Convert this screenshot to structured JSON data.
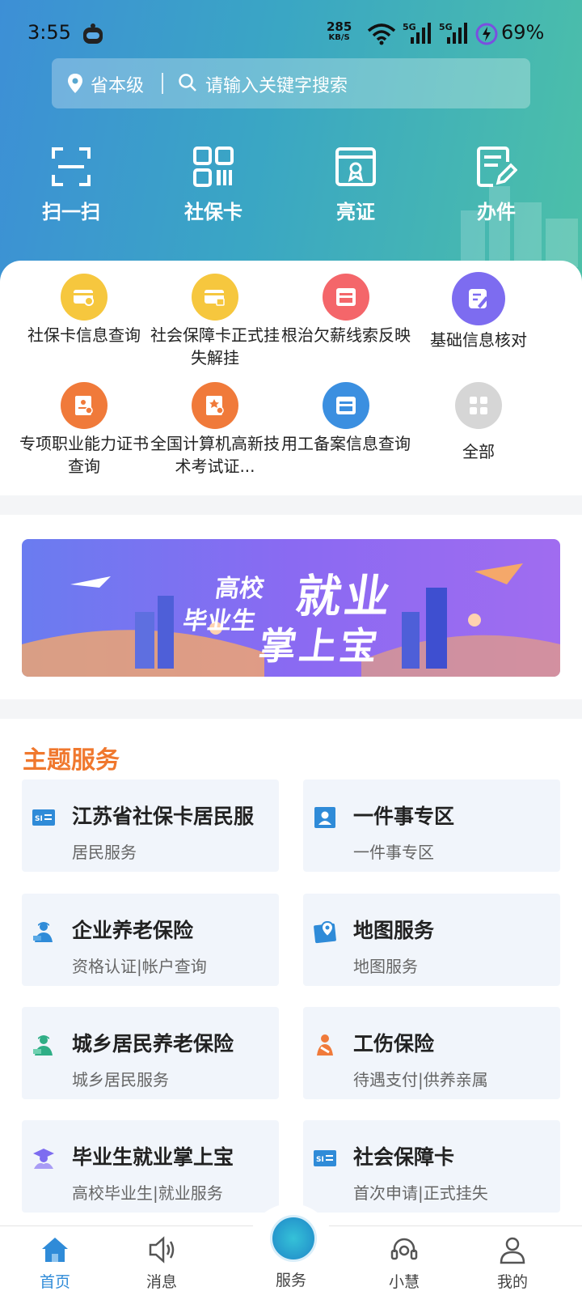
{
  "status": {
    "time": "3:55",
    "speed_value": "285",
    "speed_unit": "KB/S",
    "battery": "69%"
  },
  "search": {
    "region": "省本级",
    "placeholder": "请输入关键字搜索"
  },
  "quick_actions": [
    {
      "label": "扫一扫",
      "icon": "scan-icon"
    },
    {
      "label": "社保卡",
      "icon": "qrcode-icon"
    },
    {
      "label": "亮证",
      "icon": "certificate-icon"
    },
    {
      "label": "办件",
      "icon": "document-edit-icon"
    }
  ],
  "grid_items": [
    {
      "label": "社保卡信息查询",
      "color": "#f6c73e"
    },
    {
      "label": "社会保障卡正式挂失解挂",
      "color": "#f6c73e"
    },
    {
      "label": "根治欠薪线索反映",
      "color": "#f4666a"
    },
    {
      "label": "基础信息核对",
      "color": "#7d6cf0"
    },
    {
      "label": "专项职业能力证书查询",
      "color": "#f07a3a"
    },
    {
      "label": "全国计算机高新技术考试证...",
      "color": "#f07a3a"
    },
    {
      "label": "用工备案信息查询",
      "color": "#3b8fe0"
    },
    {
      "label": "全部",
      "color": "#d6d6d6"
    }
  ],
  "banner": {
    "line1": "高校",
    "line2": "毕业生",
    "line3": "就业",
    "line4": "掌上宝"
  },
  "theme": {
    "title": "主题服务",
    "cards": [
      {
        "title": "江苏省社保卡居民服",
        "sub": "居民服务",
        "icon": "si-card-icon"
      },
      {
        "title": "一件事专区",
        "sub": "一件事专区",
        "icon": "person-badge-icon"
      },
      {
        "title": "企业养老保险",
        "sub": "资格认证|帐户查询",
        "icon": "enterprise-worker-icon"
      },
      {
        "title": "地图服务",
        "sub": "地图服务",
        "icon": "map-icon"
      },
      {
        "title": "城乡居民养老保险",
        "sub": "城乡居民服务",
        "icon": "resident-worker-icon"
      },
      {
        "title": "工伤保险",
        "sub": "待遇支付|供养亲属",
        "icon": "injury-icon"
      },
      {
        "title": "毕业生就业掌上宝",
        "sub": "高校毕业生|就业服务",
        "icon": "graduate-icon"
      },
      {
        "title": "社会保障卡",
        "sub": "首次申请|正式挂失",
        "icon": "si-card-icon"
      }
    ]
  },
  "tabs": [
    {
      "label": "首页",
      "icon": "home-icon"
    },
    {
      "label": "消息",
      "icon": "speaker-icon"
    },
    {
      "label": "服务",
      "icon": "service-logo-icon"
    },
    {
      "label": "小慧",
      "icon": "headset-icon"
    },
    {
      "label": "我的",
      "icon": "user-icon"
    }
  ],
  "colors": {
    "accent": "#2f8bd8",
    "theme_title": "#f0782e",
    "card_bg": "#f1f5fb"
  }
}
